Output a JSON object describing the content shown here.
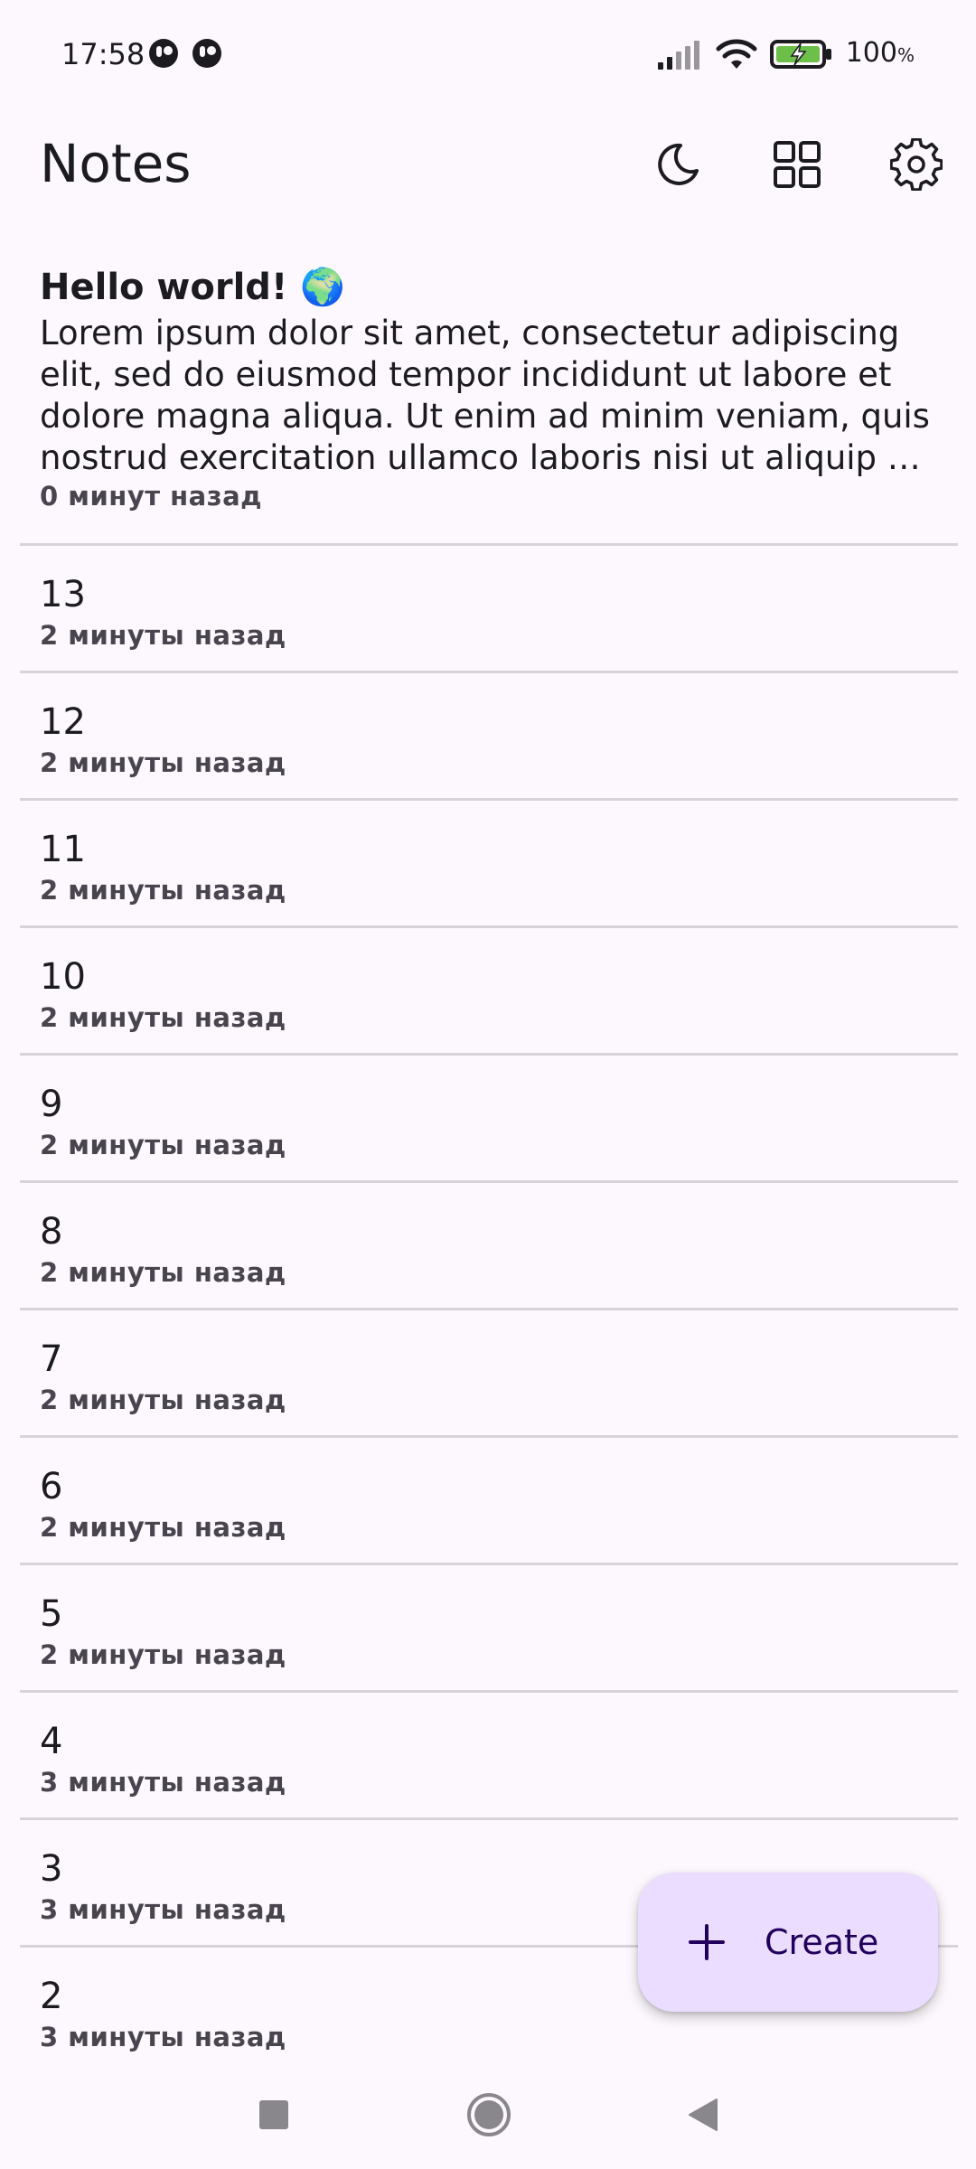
{
  "status_bar": {
    "time": "17:58",
    "battery_percent": "100",
    "battery_unit": "%"
  },
  "app_bar": {
    "title": "Notes",
    "actions": {
      "theme": "moon-icon",
      "layout": "grid-icon",
      "settings": "gear-icon"
    }
  },
  "notes": [
    {
      "title": "Hello world! 🌍",
      "body": "Lorem ipsum dolor sit amet, consectetur adipiscing elit, sed do eiusmod tempor incididunt ut labore et dolore magna aliqua. Ut enim ad minim veniam, quis nostrud exercitation ullamco laboris nisi ut aliquip ex …",
      "time": "0 минут назад"
    },
    {
      "title": "13",
      "time": "2 минуты назад"
    },
    {
      "title": "12",
      "time": "2 минуты назад"
    },
    {
      "title": "11",
      "time": "2 минуты назад"
    },
    {
      "title": "10",
      "time": "2 минуты назад"
    },
    {
      "title": "9",
      "time": "2 минуты назад"
    },
    {
      "title": "8",
      "time": "2 минуты назад"
    },
    {
      "title": "7",
      "time": "2 минуты назад"
    },
    {
      "title": "6",
      "time": "2 минуты назад"
    },
    {
      "title": "5",
      "time": "2 минуты назад"
    },
    {
      "title": "4",
      "time": "3 минуты назад"
    },
    {
      "title": "3",
      "time": "3 минуты назад"
    },
    {
      "title": "2",
      "time": "3 минуты назад"
    }
  ],
  "fab": {
    "label": "Create",
    "icon": "plus-icon"
  },
  "colors": {
    "background": "#fdf8fd",
    "fab_background": "#eaddff",
    "fab_text": "#21005d",
    "divider": "#d8d3d9",
    "battery_charge": "#6cc04a"
  }
}
